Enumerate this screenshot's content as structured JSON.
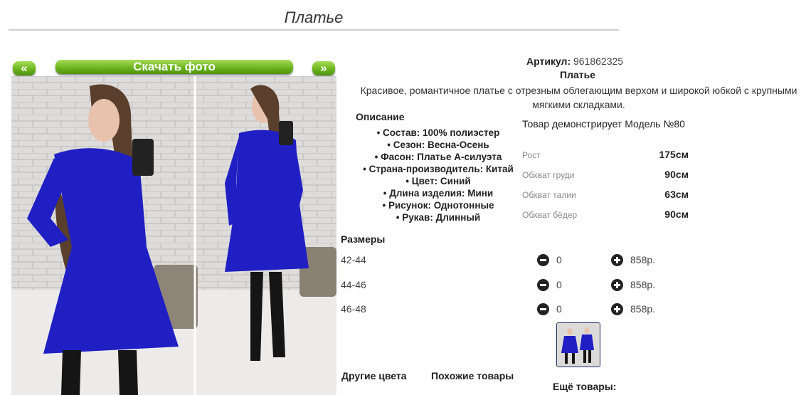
{
  "header": {
    "title": "Платье"
  },
  "gallery": {
    "prev_label": "«",
    "download_label": "Скачать фото",
    "next_label": "»"
  },
  "product": {
    "sku_label": "Артикул:",
    "sku_value": "961862325",
    "name": "Платье",
    "description": "Красивое, романтичное платье с отрезным облегающим верхом и широкой юбкой с крупными мягкими складками."
  },
  "details": {
    "heading": "Описание",
    "features": [
      "Состав: 100% полиэстер",
      "Сезон: Весна-Осень",
      "Фасон: Платье А-силуэта",
      "Страна-производитель: Китай",
      "Цвет: Синий",
      "Длина изделия: Мини",
      "Рисунок: Однотонные",
      "Рукав: Длинный"
    ]
  },
  "model": {
    "caption": "Товар демонстрирует Модель №80",
    "measurements": [
      {
        "label": "Рост",
        "value": "175см"
      },
      {
        "label": "Обхват груди",
        "value": "90см"
      },
      {
        "label": "Обхват талии",
        "value": "63см"
      },
      {
        "label": "Обхват бёдер",
        "value": "90см"
      }
    ]
  },
  "sizes": {
    "heading": "Размеры",
    "rows": [
      {
        "size": "42-44",
        "qty": "0",
        "price": "858р."
      },
      {
        "size": "44-46",
        "qty": "0",
        "price": "858р."
      },
      {
        "size": "46-48",
        "qty": "0",
        "price": "858р."
      }
    ]
  },
  "sections": {
    "other_colors": "Другие цвета",
    "similar": "Похожие товары",
    "more": "Ещё товары:"
  },
  "colors": {
    "accent_green": "#6db51f",
    "dress_blue": "#1f1fc4",
    "thumb_border": "#1c2d66"
  },
  "icons": {
    "minus": "minus-circle-icon",
    "plus": "plus-circle-icon"
  }
}
